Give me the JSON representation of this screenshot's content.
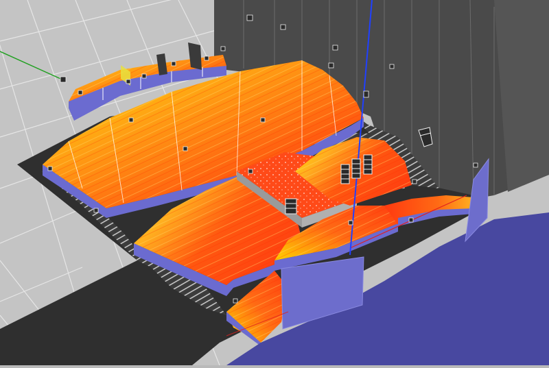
{
  "view": {
    "type": "3d-acoustic-coverage-viewport",
    "colors": {
      "floor": "#c2c2c2",
      "grid_line": "#e4e4e4",
      "walls": "#4a4a4a",
      "stage": "#4a4aa2",
      "stage_front": "#6a6ac8",
      "seating_side": "#6b6bd0",
      "coverage_low": "#ffe300",
      "coverage_mid": "#ff9e10",
      "coverage_high": "#ff3a10",
      "axis_x": "#e02020",
      "axis_y": "#20a020",
      "axis_z": "#2040ff"
    },
    "icons": [
      "speaker-array-icon",
      "speaker-cabinet-icon",
      "axis-x-icon",
      "axis-y-icon",
      "axis-z-icon"
    ],
    "seating_sections": [
      "balcony-rear",
      "balcony-upper",
      "main-rear",
      "main-center",
      "main-front-left",
      "main-front-right",
      "front-wedge"
    ]
  }
}
